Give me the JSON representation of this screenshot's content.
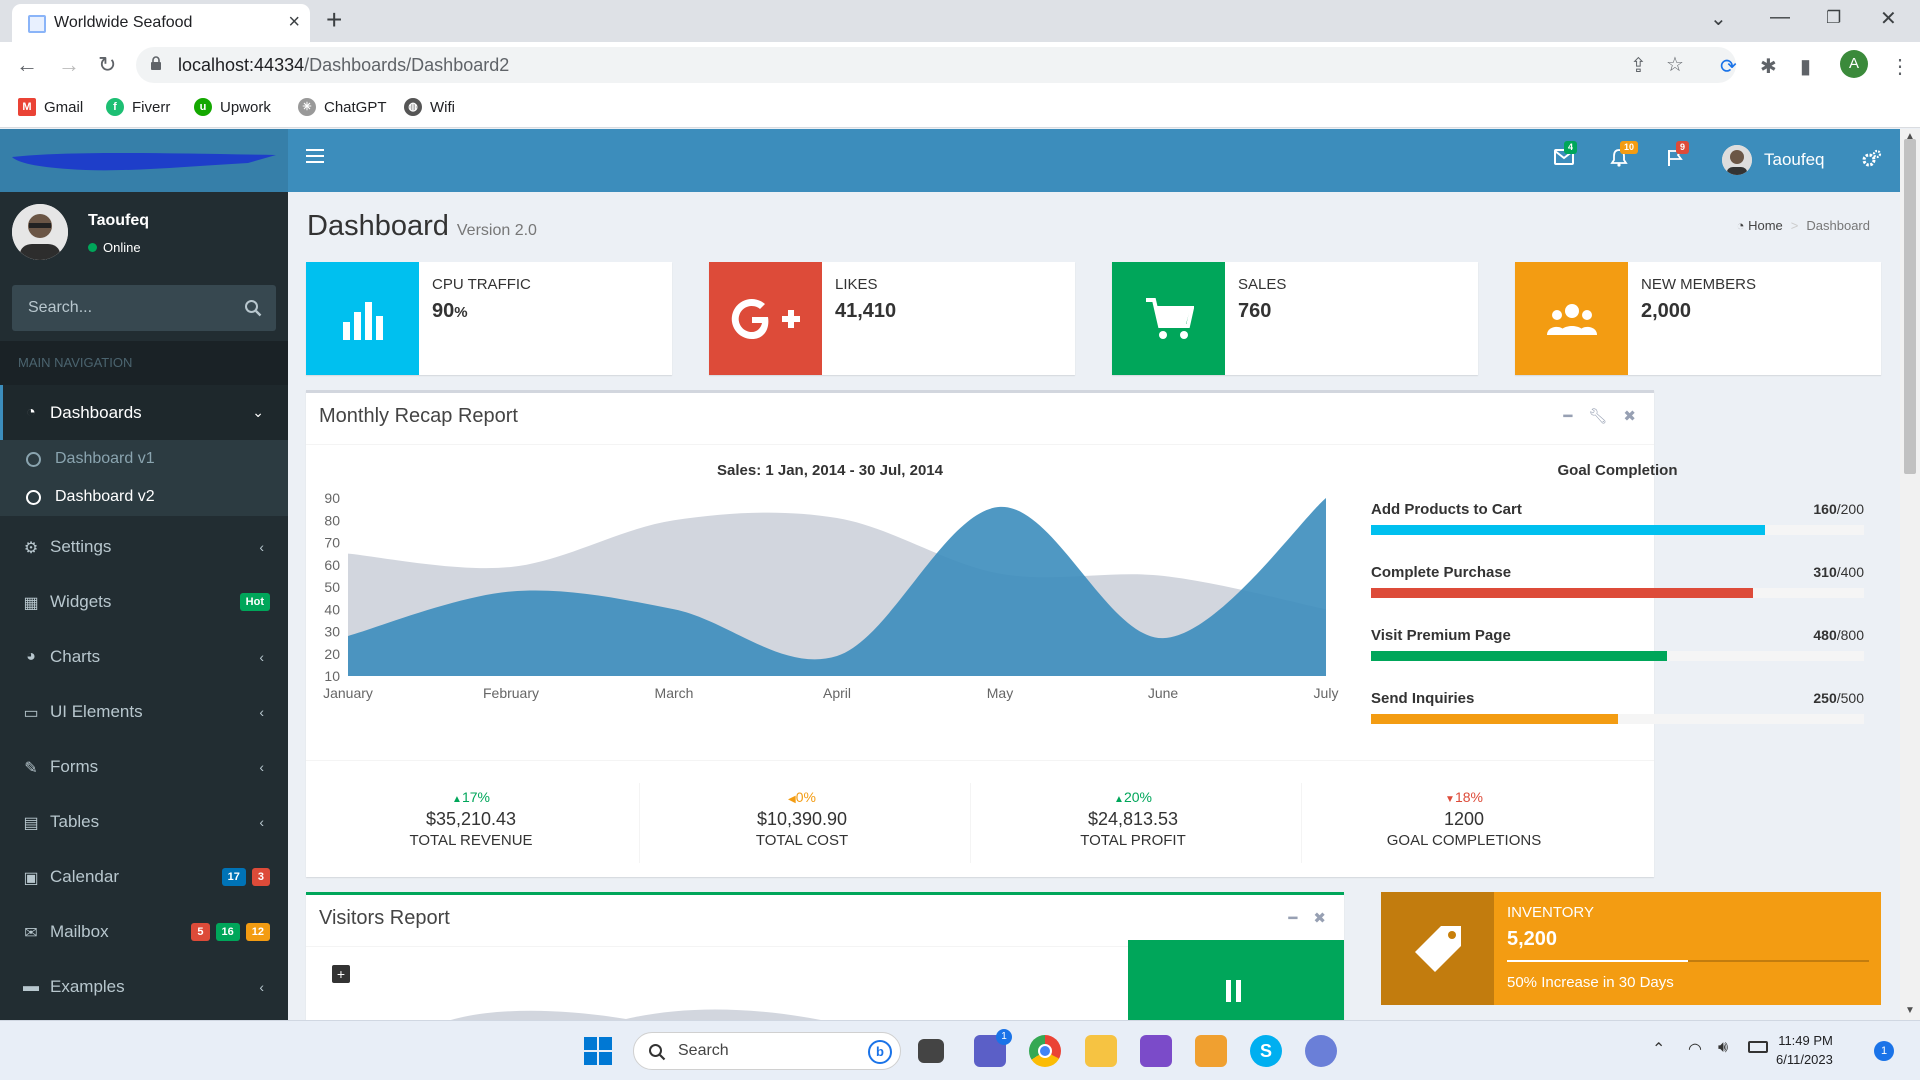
{
  "browser": {
    "tab_title": "Worldwide Seafood",
    "url_host": "localhost:44334",
    "url_path": "/Dashboards/Dashboard2",
    "profile_initial": "A",
    "bookmarks": [
      "Gmail",
      "Fiverr",
      "Upwork",
      "ChatGPT",
      "Wifi"
    ]
  },
  "header": {
    "mail_count": "4",
    "notif_count": "10",
    "tasks_count": "9",
    "user_name": "Taoufeq"
  },
  "sidebar": {
    "user_name": "Taoufeq",
    "status": "Online",
    "search_placeholder": "Search...",
    "nav_header": "MAIN NAVIGATION",
    "items": [
      {
        "label": "Dashboards",
        "icon": "dashboard-icon"
      },
      {
        "label": "Settings",
        "icon": "gear-icon"
      },
      {
        "label": "Widgets",
        "icon": "th-icon",
        "badge": "Hot"
      },
      {
        "label": "Charts",
        "icon": "pie-chart-icon"
      },
      {
        "label": "UI Elements",
        "icon": "laptop-icon"
      },
      {
        "label": "Forms",
        "icon": "edit-icon"
      },
      {
        "label": "Tables",
        "icon": "table-icon"
      },
      {
        "label": "Calendar",
        "icon": "calendar-icon",
        "badges": [
          "17",
          "3"
        ]
      },
      {
        "label": "Mailbox",
        "icon": "envelope-icon",
        "badges": [
          "5",
          "16",
          "12"
        ]
      },
      {
        "label": "Examples",
        "icon": "folder-icon"
      }
    ],
    "subitems": [
      "Dashboard v1",
      "Dashboard v2"
    ]
  },
  "page": {
    "title": "Dashboard",
    "version": "Version 2.0",
    "breadcrumb_home": "Home",
    "breadcrumb_current": "Dashboard"
  },
  "info_boxes": [
    {
      "label": "CPU TRAFFIC",
      "value": "90",
      "unit": "%",
      "color": "#00c0ef",
      "icon": "bar-chart-icon"
    },
    {
      "label": "LIKES",
      "value": "41,410",
      "color": "#dd4b39",
      "icon": "google-plus-icon"
    },
    {
      "label": "SALES",
      "value": "760",
      "color": "#00a65a",
      "icon": "shopping-cart-icon"
    },
    {
      "label": "NEW MEMBERS",
      "value": "2,000",
      "color": "#f39c12",
      "icon": "users-icon"
    }
  ],
  "recap": {
    "title": "Monthly Recap Report",
    "goal_title": "Goal Completion",
    "goals": [
      {
        "name": "Add Products to Cart",
        "value": "160",
        "max": "/200",
        "fraction": 0.8,
        "color": "#00c0ef"
      },
      {
        "name": "Complete Purchase",
        "value": "310",
        "max": "/400",
        "fraction": 0.775,
        "color": "#dd4b39"
      },
      {
        "name": "Visit Premium Page",
        "value": "480",
        "max": "/800",
        "fraction": 0.6,
        "color": "#00a65a"
      },
      {
        "name": "Send Inquiries",
        "value": "250",
        "max": "/500",
        "fraction": 0.5,
        "color": "#f39c12"
      }
    ],
    "descriptions": [
      {
        "pct": "17%",
        "dir": "up",
        "color": "#00a65a",
        "amount": "$35,210.43",
        "label": "TOTAL REVENUE"
      },
      {
        "pct": "0%",
        "dir": "left",
        "color": "#f39c12",
        "amount": "$10,390.90",
        "label": "TOTAL COST"
      },
      {
        "pct": "20%",
        "dir": "up",
        "color": "#00a65a",
        "amount": "$24,813.53",
        "label": "TOTAL PROFIT"
      },
      {
        "pct": "18%",
        "dir": "down",
        "color": "#dd4b39",
        "amount": "1200",
        "label": "GOAL COMPLETIONS"
      }
    ]
  },
  "chart_data": {
    "type": "area",
    "title": "Sales: 1 Jan, 2014 - 30 Jul, 2014",
    "categories": [
      "January",
      "February",
      "March",
      "April",
      "May",
      "June",
      "July"
    ],
    "ylim": [
      10,
      90
    ],
    "yticks": [
      10,
      20,
      30,
      40,
      50,
      60,
      70,
      80,
      90
    ],
    "grid": false,
    "series": [
      {
        "values": [
          65,
          59,
          80,
          81,
          56,
          55,
          40
        ],
        "color": "#d2d6de"
      },
      {
        "values": [
          28,
          48,
          40,
          19,
          86,
          27,
          90
        ],
        "color": "#3c8dbc"
      }
    ]
  },
  "visitors": {
    "title": "Visitors Report"
  },
  "inventory": {
    "label": "INVENTORY",
    "value": "5,200",
    "progress": 0.5,
    "description": "50% Increase in 30 Days"
  },
  "taskbar": {
    "search": "Search",
    "time": "11:49 PM",
    "date": "6/11/2023",
    "notif": "1",
    "teams_badge": "1"
  }
}
